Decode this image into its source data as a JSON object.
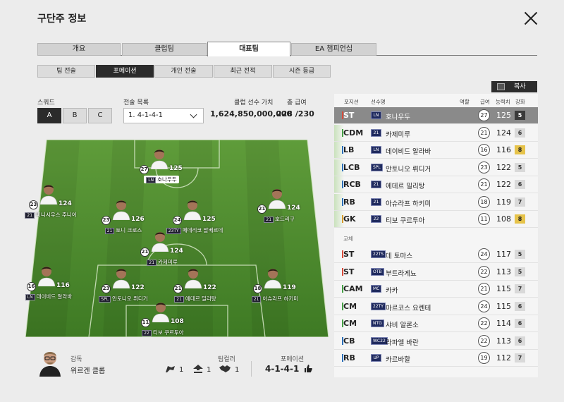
{
  "window": {
    "title": "구단주 정보"
  },
  "tabs": [
    {
      "label": "개요",
      "active": false
    },
    {
      "label": "클럽팀",
      "active": false
    },
    {
      "label": "대표팀",
      "active": true
    },
    {
      "label": "EA 챔피언십",
      "active": false
    }
  ],
  "subtabs": [
    {
      "label": "팀 전술",
      "active": false
    },
    {
      "label": "포메이션",
      "active": true
    },
    {
      "label": "개인 전술",
      "active": false
    },
    {
      "label": "최근 전적",
      "active": false
    },
    {
      "label": "시즌 등급",
      "active": false
    }
  ],
  "squad": {
    "label": "스쿼드",
    "options": [
      "A",
      "B",
      "C"
    ],
    "selected": "A"
  },
  "tactics": {
    "label": "전술 목록",
    "selected": "1. 4-1-4-1"
  },
  "club_value": {
    "label": "클럽 선수 가치",
    "value": "1,624,850,000,000"
  },
  "salary": {
    "label": "총 급여",
    "value": "228 /230"
  },
  "pitch_players": [
    {
      "name": "호나우두",
      "season": "LN",
      "pay": "27",
      "ovr": "125",
      "selected": true
    },
    {
      "name": "비니시우스 주니어",
      "season": "21",
      "pay": "23",
      "ovr": "124"
    },
    {
      "name": "토니 크로스",
      "season": "21",
      "pay": "23",
      "ovr": "126"
    },
    {
      "name": "페데리코 발베르데",
      "season": "23TY",
      "pay": "24",
      "ovr": "125"
    },
    {
      "name": "호드리구",
      "season": "21",
      "pay": "21",
      "ovr": "124"
    },
    {
      "name": "카제미루",
      "season": "21",
      "pay": "21",
      "ovr": "124"
    },
    {
      "name": "데이비드 알라바",
      "season": "LN",
      "pay": "16",
      "ovr": "116"
    },
    {
      "name": "안토니오 뤼디거",
      "season": "SPL",
      "pay": "23",
      "ovr": "122"
    },
    {
      "name": "에데르 밀리탕",
      "season": "21",
      "pay": "21",
      "ovr": "122"
    },
    {
      "name": "아슈라프 하키미",
      "season": "21",
      "pay": "18",
      "ovr": "119"
    },
    {
      "name": "티보 쿠르투아",
      "season": "22",
      "pay": "11",
      "ovr": "108"
    }
  ],
  "coach": {
    "label": "감독",
    "name": "위르겐 클롭",
    "avatar_icon": "coach-avatar"
  },
  "chemistry": {
    "label": "팀컬러",
    "values": [
      "1",
      "1",
      "1"
    ],
    "icons": [
      "flag-icon",
      "arrow-up-icon",
      "handshake-icon"
    ]
  },
  "formation": {
    "label": "포메이션",
    "value": "4-1-4-1",
    "icon": "thumb-icon"
  },
  "copy_button": {
    "label": "복사"
  },
  "list_headers": {
    "position": "포지션",
    "name": "선수명",
    "role": "역할",
    "pay": "급여",
    "ovr": "능력치",
    "enhance": "강화"
  },
  "starters": [
    {
      "pos": "ST",
      "season": "LN",
      "name": "호나우두",
      "pay": "27",
      "ovr": "125",
      "enh": "5",
      "color": "#d84b3a",
      "selected": true
    },
    {
      "pos": "CDM",
      "season": "21",
      "name": "카제미루",
      "pay": "21",
      "ovr": "124",
      "enh": "6",
      "color": "#46a046"
    },
    {
      "pos": "LB",
      "season": "LN",
      "name": "데이비드 알라바",
      "pay": "16",
      "ovr": "116",
      "enh": "8",
      "color": "#2c6fb8",
      "gold": true
    },
    {
      "pos": "LCB",
      "season": "SPL",
      "name": "안토니오 뤼디거",
      "pay": "23",
      "ovr": "122",
      "enh": "5",
      "color": "#2c6fb8"
    },
    {
      "pos": "RCB",
      "season": "21",
      "name": "에데르 밀리탕",
      "pay": "21",
      "ovr": "122",
      "enh": "6",
      "color": "#2c6fb8"
    },
    {
      "pos": "RB",
      "season": "21",
      "name": "아슈라프 하키미",
      "pay": "18",
      "ovr": "119",
      "enh": "7",
      "color": "#2c6fb8"
    },
    {
      "pos": "GK",
      "season": "22",
      "name": "티보 쿠르투아",
      "pay": "11",
      "ovr": "108",
      "enh": "8",
      "color": "#d69a2c",
      "gold": true
    }
  ],
  "subs_label": "교체",
  "subs": [
    {
      "pos": "ST",
      "season": "22TS",
      "name": "데 토마스",
      "pay": "24",
      "ovr": "117",
      "enh": "5",
      "color": "#d84b3a"
    },
    {
      "pos": "ST",
      "season": "OTB",
      "name": "부트라게뇨",
      "pay": "22",
      "ovr": "113",
      "enh": "5",
      "color": "#d84b3a"
    },
    {
      "pos": "CAM",
      "season": "MC",
      "name": "카카",
      "pay": "21",
      "ovr": "115",
      "enh": "7",
      "color": "#46a046"
    },
    {
      "pos": "CM",
      "season": "22TY",
      "name": "마르코스 요렌테",
      "pay": "24",
      "ovr": "115",
      "enh": "6",
      "color": "#46a046"
    },
    {
      "pos": "CM",
      "season": "NTG",
      "name": "샤비 알론소",
      "pay": "22",
      "ovr": "114",
      "enh": "6",
      "color": "#46a046"
    },
    {
      "pos": "CB",
      "season": "WC22",
      "name": "라파엘 바란",
      "pay": "22",
      "ovr": "113",
      "enh": "6",
      "color": "#2c6fb8"
    },
    {
      "pos": "RB",
      "season": "UP",
      "name": "카르바할",
      "pay": "19",
      "ovr": "112",
      "enh": "7",
      "color": "#2c6fb8"
    }
  ]
}
